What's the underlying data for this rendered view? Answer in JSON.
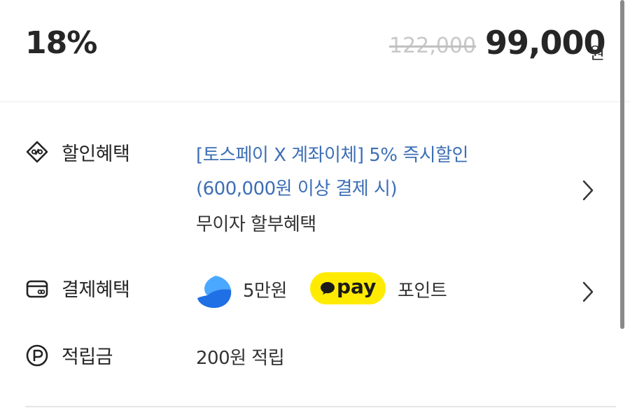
{
  "price": {
    "discount_rate": "18%",
    "original_price": "122,000",
    "sale_price": "99,000",
    "currency": "원"
  },
  "discount_benefit": {
    "icon": "discount-tag-icon",
    "label": "할인혜택",
    "promo_line1": "[토스페이 X 계좌이체] 5% 즉시할인",
    "promo_line2": "(600,000원 이상 결제 시)",
    "installment": "무이자 할부혜택"
  },
  "payment_benefit": {
    "icon": "card-icon",
    "label": "결제혜택",
    "toss_amount": "5만원",
    "kakao_pay_label": "pay",
    "point_text": "포인트"
  },
  "reward": {
    "icon": "point-p-icon",
    "label": "적립금",
    "value": "200원 적립"
  },
  "colors": {
    "link_blue": "#3d6fb5",
    "kakao_yellow": "#ffeb00",
    "toss_blue": "#1f6fe5"
  }
}
